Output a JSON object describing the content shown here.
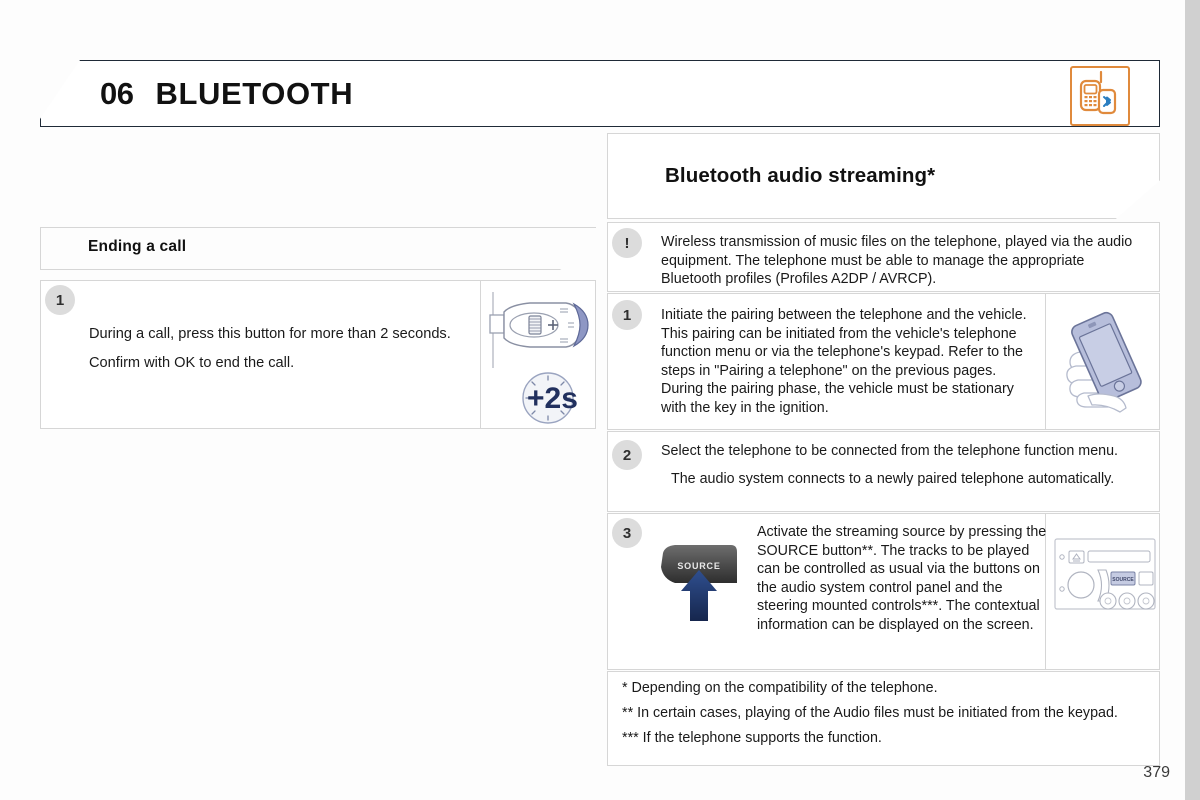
{
  "page": {
    "number": "379",
    "chapter_number": "06",
    "chapter_title": "BLUETOOTH",
    "header_icon": "bluetooth-phone-icon",
    "accent_orange": "#e08a3c",
    "accent_blue": "#2a3f78",
    "badge_gray": "#dcdcdc",
    "border_gray": "#d6d6d6",
    "header_border": "#1f2a37"
  },
  "left_column": {
    "heading": "Ending a call",
    "step": {
      "number": "1",
      "lines": [
        "During a call, press this button for more than 2 seconds.",
        "Confirm with OK to end the call."
      ],
      "illustration": "steering-stalk-control",
      "illustration_label": "+2s"
    }
  },
  "right_column": {
    "heading": "Bluetooth audio streaming*",
    "note": {
      "icon": "exclamation-icon",
      "text": "Wireless transmission of music files on the telephone, played via the audio equipment. The telephone must be able to manage the appropriate Bluetooth profiles (Profiles A2DP / AVRCP)."
    },
    "steps": [
      {
        "number": "1",
        "text": "Initiate the pairing between the telephone and the vehicle. This pairing can be initiated from the vehicle's telephone function menu or via the telephone's keypad. Refer to the steps in \"Pairing a telephone\" on the previous pages. During the pairing phase, the vehicle must be stationary with the key in the ignition.",
        "illustration": "hand-holding-smartphone"
      },
      {
        "number": "2",
        "text": "Select the telephone to be connected from the telephone function menu.",
        "subtext": "The audio system connects to a newly paired telephone automatically."
      },
      {
        "number": "3",
        "text": "Activate the streaming source by pressing the SOURCE button**. The tracks to be played can be controlled as usual via the buttons on the audio system control panel and the steering mounted controls***. The contextual information can be displayed on the screen.",
        "button_label": "SOURCE",
        "illustration_left": "source-button-with-arrow",
        "illustration_right": "car-audio-head-unit"
      }
    ],
    "footnotes": [
      "* Depending on the compatibility of the telephone.",
      "** In certain cases, playing of the Audio files must be initiated from the keypad.",
      "*** If the telephone supports the function."
    ]
  }
}
